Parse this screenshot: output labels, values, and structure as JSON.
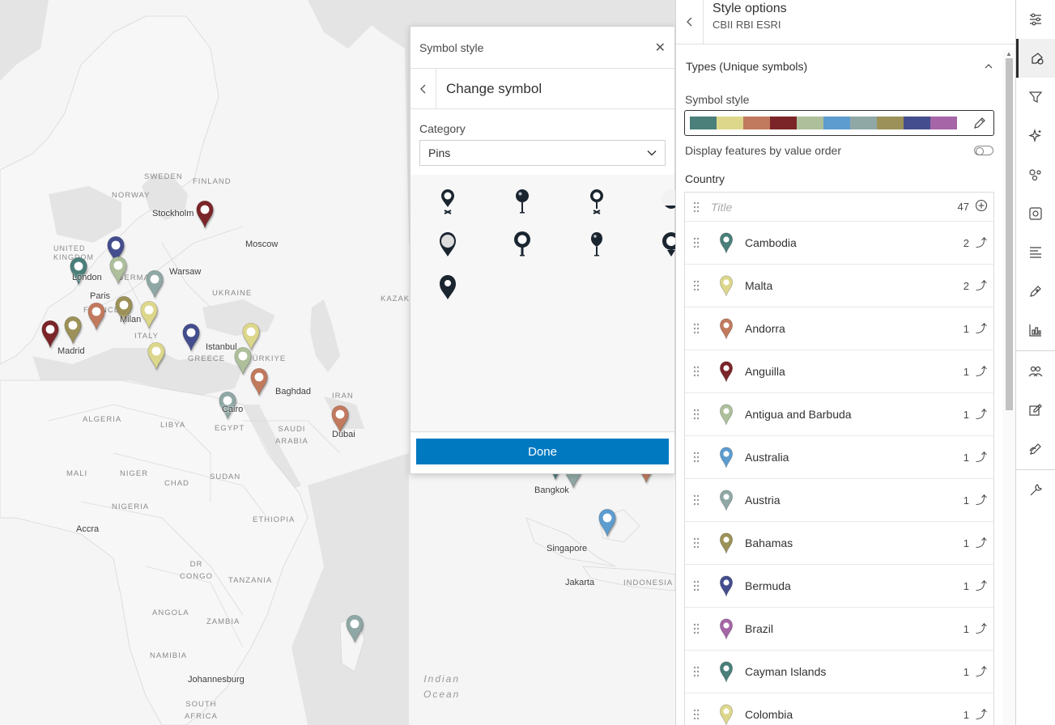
{
  "map": {
    "cities": [
      {
        "name": "Stockholm"
      },
      {
        "name": "Moscow"
      },
      {
        "name": "London"
      },
      {
        "name": "Warsaw"
      },
      {
        "name": "Paris"
      },
      {
        "name": "Milan"
      },
      {
        "name": "Madrid"
      },
      {
        "name": "Istanbul"
      },
      {
        "name": "Baghdad"
      },
      {
        "name": "Cairo"
      },
      {
        "name": "Dubai"
      },
      {
        "name": "Accra"
      },
      {
        "name": "Bangkok"
      },
      {
        "name": "Singapore"
      },
      {
        "name": "Jakarta"
      },
      {
        "name": "Johannesburg"
      }
    ],
    "countries": [
      "SWEDEN",
      "FINLAND",
      "NORWAY",
      "UNITED KINGDOM",
      "GERMANY",
      "UKRAINE",
      "FRANCE",
      "ITALY",
      "TÜRKIYE",
      "GREECE",
      "KAZAK",
      "IRAN",
      "ALGERIA",
      "LIBYA",
      "EGYPT",
      "SAUDI ARABIA",
      "MALI",
      "NIGER",
      "CHAD",
      "SUDAN",
      "NIGERIA",
      "ETHIOPIA",
      "DR CONGO",
      "TANZANIA",
      "ANGOLA",
      "ZAMBIA",
      "NAMIBIA",
      "SOUTH AFRICA",
      "INDONESIA"
    ],
    "ocean": "Indian Ocean"
  },
  "popup": {
    "title": "Symbol style",
    "subtitle": "Change symbol",
    "category_label": "Category",
    "category_value": "Pins",
    "done_label": "Done",
    "symbols": [
      "pin-ring-x",
      "pin-ball-stem",
      "pin-ring-stem",
      "pin-light-drop",
      "pin-gray-drop",
      "pin-ring-stem-2",
      "pin-ball-stem-2",
      "pin-ring-drop",
      "pin-solid-drop"
    ]
  },
  "panel": {
    "title": "Style options",
    "subtitle": "CBII RBI ESRI",
    "types_header": "Types (Unique symbols)",
    "symbol_style_label": "Symbol style",
    "ramp_colors": [
      "#4a7f7a",
      "#ddd78c",
      "#c17a5e",
      "#7b2528",
      "#aebf9c",
      "#5d9ccf",
      "#8fa8a5",
      "#9c9158",
      "#444e8e",
      "#a565a7"
    ],
    "display_order_label": "Display features by value order",
    "field_label": "Country",
    "title_placeholder": "Title",
    "total_count": "47",
    "items": [
      {
        "name": "Cambodia",
        "count": "2",
        "color": "#4a7f7a"
      },
      {
        "name": "Malta",
        "count": "2",
        "color": "#ddd78c"
      },
      {
        "name": "Andorra",
        "count": "1",
        "color": "#c17a5e"
      },
      {
        "name": "Anguilla",
        "count": "1",
        "color": "#7b2528"
      },
      {
        "name": "Antigua and Barbuda",
        "count": "1",
        "color": "#aebf9c"
      },
      {
        "name": "Australia",
        "count": "1",
        "color": "#5d9ccf"
      },
      {
        "name": "Austria",
        "count": "1",
        "color": "#8fa8a5"
      },
      {
        "name": "Bahamas",
        "count": "1",
        "color": "#9c9158"
      },
      {
        "name": "Bermuda",
        "count": "1",
        "color": "#444e8e"
      },
      {
        "name": "Brazil",
        "count": "1",
        "color": "#a565a7"
      },
      {
        "name": "Cayman Islands",
        "count": "1",
        "color": "#4a7f7a"
      },
      {
        "name": "Colombia",
        "count": "1",
        "color": "#ddd78c"
      }
    ]
  },
  "tools": [
    "properties-icon",
    "styles-icon",
    "filter-icon",
    "effects-icon",
    "aggregation-icon",
    "clustering-icon",
    "labels-icon",
    "sketch-icon",
    "chart-icon",
    "manage-icon",
    "edit-icon",
    "annotate-icon",
    "wrench-icon"
  ]
}
